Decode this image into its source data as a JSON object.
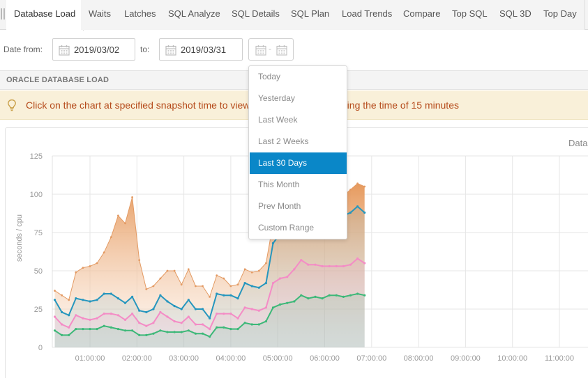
{
  "tabs": [
    {
      "label": "Database Load",
      "active": true
    },
    {
      "label": "Waits"
    },
    {
      "label": "Latches"
    },
    {
      "label": "SQL Analyze"
    },
    {
      "label": "SQL Details"
    },
    {
      "label": "SQL Plan"
    },
    {
      "label": "Load Trends"
    },
    {
      "label": "Compare"
    },
    {
      "label": "Top SQL"
    },
    {
      "label": "SQL 3D"
    },
    {
      "label": "Top Day"
    }
  ],
  "date_filter": {
    "from_label": "Date from:",
    "from_value": "2019/03/02",
    "to_label": "to:",
    "to_value": "2019/03/31",
    "range_separator": "-"
  },
  "section": {
    "title": "ORACLE DATABASE LOAD"
  },
  "alert": {
    "message": "Click on the chart at specified snapshot time to view                                    or alerts executed during the time of 15 minutes"
  },
  "dropdown": {
    "items": [
      "Today",
      "Yesterday",
      "Last Week",
      "Last 2 Weeks",
      "Last 30 Days",
      "This Month",
      "Prev Month",
      "Custom Range"
    ],
    "selected": "Last 30 Days"
  },
  "chart_title_partial": "Datab",
  "colors": {
    "accent": "#0a87c8",
    "alert_bg": "#f9f0d9",
    "alert_text": "#b54a1a",
    "series_total": "#e39a63",
    "series_blue": "#2596be",
    "series_pink": "#f48cc6",
    "series_green": "#3cb878"
  },
  "chart_data": {
    "type": "area",
    "title": "",
    "xlabel": "",
    "ylabel": "seconds / cpu",
    "ylim": [
      0,
      125
    ],
    "yticks": [
      0,
      25,
      50,
      75,
      100,
      125
    ],
    "xticks": [
      "01:00:00",
      "02:00:00",
      "03:00:00",
      "04:00:00",
      "05:00:00",
      "06:00:00",
      "07:00:00",
      "08:00:00",
      "09:00:00",
      "10:00:00",
      "11:00:00"
    ],
    "x_start_hour": 0.25,
    "x_step_hours": 0.15,
    "grid": true,
    "series": [
      {
        "color": "#e39a63",
        "values": [
          37,
          34,
          31,
          49,
          52,
          53,
          55,
          62,
          72,
          86,
          81,
          98,
          57,
          38,
          40,
          45,
          50,
          50,
          41,
          51,
          40,
          40,
          33,
          47,
          45,
          40,
          41,
          51,
          49,
          50,
          55,
          81,
          87,
          88,
          95,
          105,
          99,
          102,
          97,
          103,
          102,
          99,
          103,
          107,
          105
        ]
      },
      {
        "color": "#2596be",
        "values": [
          31,
          23,
          21,
          32,
          31,
          30,
          31,
          35,
          35,
          32,
          29,
          33,
          24,
          23,
          25,
          34,
          30,
          27,
          25,
          31,
          25,
          25,
          19,
          35,
          34,
          34,
          32,
          42,
          40,
          39,
          42,
          68,
          74,
          76,
          82,
          91,
          86,
          86,
          84,
          87,
          87,
          86,
          88,
          92,
          88
        ]
      },
      {
        "color": "#f48cc6",
        "values": [
          20,
          15,
          13,
          21,
          19,
          18,
          19,
          22,
          22,
          21,
          18,
          22,
          16,
          14,
          16,
          23,
          20,
          17,
          16,
          20,
          15,
          15,
          12,
          22,
          22,
          22,
          19,
          26,
          25,
          24,
          26,
          42,
          45,
          46,
          51,
          57,
          54,
          54,
          53,
          53,
          53,
          53,
          54,
          58,
          55
        ]
      },
      {
        "color": "#3cb878",
        "values": [
          11,
          8,
          8,
          12,
          12,
          12,
          12,
          14,
          13,
          12,
          11,
          11,
          8,
          8,
          9,
          11,
          10,
          10,
          10,
          11,
          9,
          9,
          7,
          13,
          13,
          12,
          12,
          16,
          15,
          15,
          17,
          26,
          28,
          29,
          30,
          34,
          32,
          33,
          32,
          34,
          34,
          33,
          34,
          35,
          34
        ]
      }
    ]
  }
}
